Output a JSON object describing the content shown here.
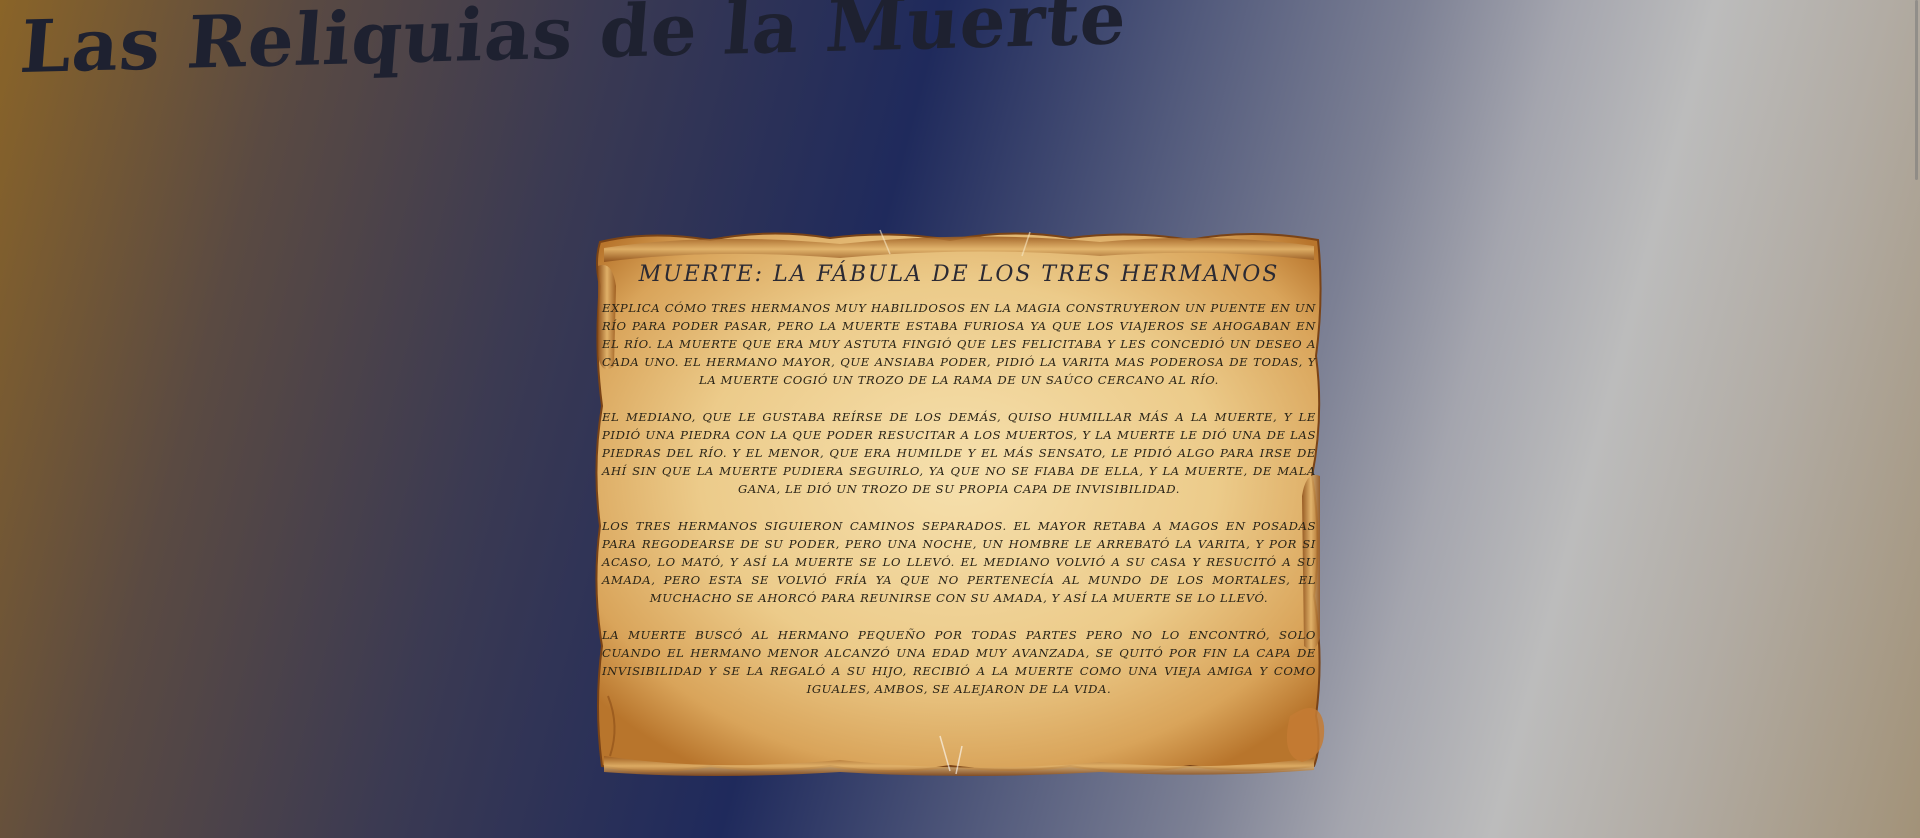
{
  "page": {
    "title": "Las Reliquias de la Muerte"
  },
  "scroll": {
    "heading": "Muerte: La Fábula de los Tres Hermanos",
    "paragraphs": [
      "Explica cómo tres hermanos muy habilidosos en la magia construyeron un puente en un río para poder pasar, pero la muerte estaba furiosa ya que los viajeros se ahogaban en el río. La muerte que era muy astuta fingió que les felicitaba y les concedió un deseo a cada uno. El hermano mayor, que ansiaba poder, pidió la varita mas poderosa de todas, y la muerte cogió un trozo de la rama de un saúco cercano al río.",
      "El mediano, que le gustaba reírse de los demás, quiso humillar más a la muerte, y le pidió una piedra con la que poder resucitar a los muertos, y la muerte le dió una de las piedras del río. Y el menor, que era humilde y el más sensato, le pidió algo para irse de ahí sin que la muerte pudiera seguirlo, ya que no se fiaba de ella, y la muerte, de mala gana, le dió un trozo de su propia capa de invisibilidad.",
      "Los tres hermanos siguieron caminos separados. El mayor retaba a magos en posadas para regodearse de su poder, pero una noche, un hombre le arrebató la varita, y por si acaso, lo mató, y así la muerte se lo llevó. El mediano volvió a su casa y resucitó a su amada, pero esta se volvió fría ya que no pertenecía al mundo de los mortales, el muchacho se ahorcó para reunirse con su amada, y así la muerte se lo llevó.",
      "La muerte buscó al hermano pequeño por todas partes pero no lo encontró, solo cuando el hermano menor alcanzó una edad muy avanzada, se quitó por fin la capa de invisibilidad y se la regaló a su hijo, recibió a la muerte como una vieja amiga y como iguales, ambos, se alejaron de la vida."
    ]
  },
  "colors": {
    "title": "#1e2130",
    "parchment_light": "#f3d9a4",
    "parchment_dark": "#b8752c",
    "text": "#2a2417"
  }
}
